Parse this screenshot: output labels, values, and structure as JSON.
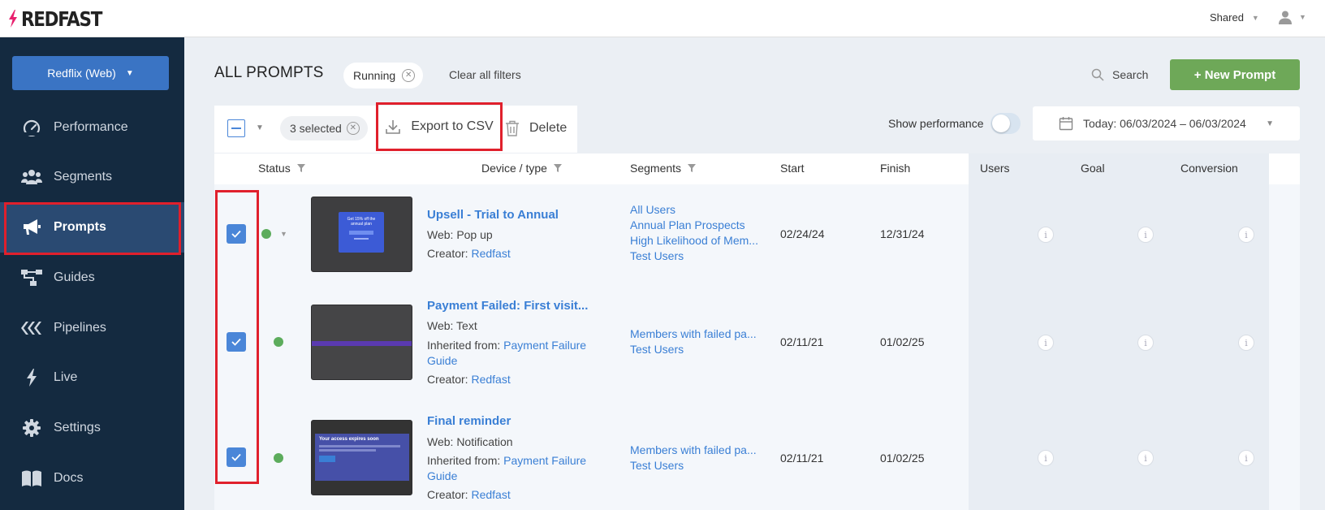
{
  "header": {
    "logo_text": "REDFAST",
    "workspace_label": "Shared"
  },
  "sidebar": {
    "app_selector": "Redflix (Web)",
    "items": [
      {
        "label": "Performance",
        "icon": "gauge-icon"
      },
      {
        "label": "Segments",
        "icon": "users-icon"
      },
      {
        "label": "Prompts",
        "icon": "megaphone-icon",
        "active": true
      },
      {
        "label": "Guides",
        "icon": "flow-icon"
      },
      {
        "label": "Pipelines",
        "icon": "pipelines-icon"
      },
      {
        "label": "Live",
        "icon": "bolt-icon"
      },
      {
        "label": "Settings",
        "icon": "gear-icon"
      },
      {
        "label": "Docs",
        "icon": "book-icon"
      }
    ]
  },
  "page": {
    "title": "ALL PROMPTS",
    "filter_chip": "Running",
    "clear_filters": "Clear all filters",
    "search_label": "Search",
    "new_button": "+ New Prompt"
  },
  "toolbar": {
    "selected_label": "3 selected",
    "export_label": "Export to CSV",
    "delete_label": "Delete",
    "show_performance_label": "Show performance",
    "show_performance_on": false,
    "date_range": "Today: 06/03/2024 – 06/03/2024"
  },
  "table": {
    "columns": {
      "status": "Status",
      "device_type": "Device / type",
      "segments": "Segments",
      "start": "Start",
      "finish": "Finish",
      "users": "Users",
      "goal": "Goal",
      "conversion": "Conversion"
    },
    "rows": [
      {
        "checked": true,
        "name": "Upsell - Trial to Annual",
        "type": "Web: Pop up",
        "creator_label": "Creator:",
        "creator": "Redfast",
        "segments": [
          "All Users",
          "Annual Plan Prospects",
          "High Likelihood of Mem...",
          "Test Users"
        ],
        "start": "02/24/24",
        "finish": "12/31/24",
        "thumb_text": "Get 15% off the annual plan"
      },
      {
        "checked": true,
        "name": "Payment Failed: First visit...",
        "type": "Web: Text",
        "inherited_label": "Inherited from:",
        "inherited_line1": "Payment Failure",
        "inherited_line2": "Guide",
        "creator_label": "Creator:",
        "creator": "Redfast",
        "segments": [
          "Members with failed pa...",
          "Test Users"
        ],
        "start": "02/11/21",
        "finish": "01/02/25"
      },
      {
        "checked": true,
        "name": "Final reminder",
        "type": "Web: Notification",
        "inherited_label": "Inherited from:",
        "inherited_line1": "Payment Failure",
        "inherited_line2": "Guide",
        "creator_label": "Creator:",
        "creator": "Redfast",
        "segments": [
          "Members with failed pa...",
          "Test Users"
        ],
        "start": "02/11/21",
        "finish": "01/02/25",
        "thumb_text": "Your access expires soon"
      }
    ]
  },
  "colors": {
    "sidebar_bg": "#142a40",
    "active_item_bg": "#2a4a72",
    "accent_blue": "#3a7fd5",
    "new_button_green": "#6ea858",
    "highlight_red": "#e0202c",
    "status_green": "#5cac5c"
  }
}
